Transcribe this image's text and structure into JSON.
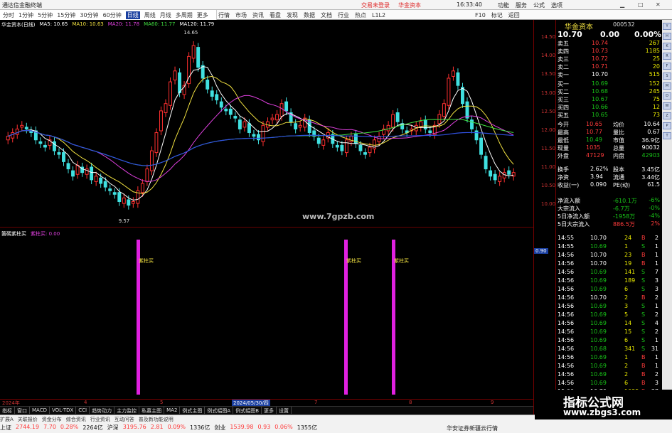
{
  "app": {
    "title": "通达信金融终端",
    "menu": [
      "行情",
      "市场",
      "资讯",
      "看盘",
      "发现",
      "数据",
      "文档",
      "行业",
      "热点",
      "L1L2"
    ],
    "right_title_links": [
      "交易未登录",
      "华金资本"
    ],
    "clock": "16:33:40",
    "title_buttons": [
      "功能",
      "服务",
      "公式",
      "选项"
    ]
  },
  "periods": [
    "分时",
    "1分钟",
    "5分钟",
    "15分钟",
    "30分钟",
    "60分钟",
    "日线",
    "周线",
    "月线",
    "多周期",
    "更多"
  ],
  "active_period": "日线",
  "right_menu": [
    "F10",
    "标记",
    "返回"
  ],
  "chart_header": {
    "stock": "华金资本(日线)",
    "ma": [
      {
        "label": "MA5: 10.65",
        "color": "#ffffff"
      },
      {
        "label": "MA10: 10.63",
        "color": "#f0e040"
      },
      {
        "label": "MA20: 11.78",
        "color": "#e040e0"
      },
      {
        "label": "MA60: 11.77",
        "color": "#40e040"
      },
      {
        "label": "MA120: 11.79",
        "color": "#ffffff"
      }
    ]
  },
  "price_labels": {
    "high": "14.65",
    "low": "9.57"
  },
  "price_scale": [
    "14.50",
    "14.00",
    "13.50",
    "13.00",
    "12.50",
    "12.00",
    "11.50",
    "11.00",
    "10.50",
    "10.00"
  ],
  "watermark_center": "www.7gpzb.com",
  "indicator": {
    "name": "籌碼紫柱买",
    "sub": "紫柱买: 0.00",
    "marker": "紫柱买",
    "value_badge": "0.90"
  },
  "x_axis": [
    {
      "label": "2024年",
      "highlight": false
    },
    {
      "label": "4",
      "highlight": false
    },
    {
      "label": "5",
      "highlight": false
    },
    {
      "label": "2024/05/30/四",
      "highlight": true
    },
    {
      "label": "7",
      "highlight": false
    },
    {
      "label": "8",
      "highlight": false
    },
    {
      "label": "9",
      "highlight": false
    }
  ],
  "tabs": [
    "指标",
    "窗口",
    "MACD",
    "VOL-TDX",
    "CCI",
    "趋势动力",
    "主力监控",
    "私募主图",
    "MA2",
    "例式主图",
    "例式幅图A",
    "例式幅图B",
    "更多",
    "设置"
  ],
  "tabs2": [
    "扩展A",
    "关联报价",
    "资金分布",
    "综合资讯",
    "行业资讯",
    "互动问答",
    "普及新功能说明"
  ],
  "quote_panel": {
    "name": "华金资本",
    "code": "000532",
    "price": "10.70",
    "change": "0.00",
    "pct": "0.00%",
    "asks": [
      {
        "label": "卖五",
        "price": "10.74",
        "vol": "267"
      },
      {
        "label": "卖四",
        "price": "10.73",
        "vol": "1185"
      },
      {
        "label": "卖三",
        "price": "10.72",
        "vol": "25"
      },
      {
        "label": "卖二",
        "price": "10.71",
        "vol": "20"
      },
      {
        "label": "卖一",
        "price": "10.70",
        "vol": "515"
      }
    ],
    "bids": [
      {
        "label": "买一",
        "price": "10.69",
        "vol": "152"
      },
      {
        "label": "买二",
        "price": "10.68",
        "vol": "245"
      },
      {
        "label": "买三",
        "price": "10.67",
        "vol": "75"
      },
      {
        "label": "买四",
        "price": "10.66",
        "vol": "12"
      },
      {
        "label": "买五",
        "price": "10.65",
        "vol": "73"
      }
    ],
    "stats": [
      {
        "l1": "今开",
        "v1": "10.65",
        "l2": "均价",
        "v2": "10.64"
      },
      {
        "l1": "最高",
        "v1": "10.77",
        "l2": "量比",
        "v2": "0.67"
      },
      {
        "l1": "最低",
        "v1": "10.49",
        "l2": "市值",
        "v2": "36.9亿"
      },
      {
        "l1": "现量",
        "v1": "1035",
        "l2": "总量",
        "v2": "90032"
      },
      {
        "l1": "外盘",
        "v1": "47129",
        "l2": "内盘",
        "v2": "42903"
      }
    ],
    "stats2": [
      {
        "l1": "换手",
        "v1": "2.62%",
        "l2": "股本",
        "v2": "3.45亿"
      },
      {
        "l1": "净资",
        "v1": "3.94",
        "l2": "流通",
        "v2": "3.44亿"
      },
      {
        "l1": "收益(一)",
        "v1": "0.090",
        "l2": "PE(动)",
        "v2": "61.5"
      }
    ],
    "flows": [
      {
        "label": "净流入额",
        "value": "-610.1万",
        "pct": "-6%"
      },
      {
        "label": "大宗流入",
        "value": "-6.7万",
        "pct": "-0%"
      },
      {
        "label": "5日净流入额",
        "value": "-1958万",
        "pct": "-4%"
      },
      {
        "label": "5日大宗流入",
        "value": "886.5万",
        "pct": "2%"
      }
    ],
    "ticks": [
      {
        "t": "14:55",
        "p": "10.70",
        "v": "24",
        "s": "B",
        "n": "2"
      },
      {
        "t": "14:55",
        "p": "10.69",
        "v": "1",
        "s": "S",
        "n": "1"
      },
      {
        "t": "14:56",
        "p": "10.70",
        "v": "23",
        "s": "B",
        "n": "1"
      },
      {
        "t": "14:56",
        "p": "10.70",
        "v": "19",
        "s": "B",
        "n": "1"
      },
      {
        "t": "14:56",
        "p": "10.69",
        "v": "141",
        "s": "S",
        "n": "7"
      },
      {
        "t": "14:56",
        "p": "10.69",
        "v": "189",
        "s": "S",
        "n": "3"
      },
      {
        "t": "14:56",
        "p": "10.69",
        "v": "6",
        "s": "S",
        "n": "3"
      },
      {
        "t": "14:56",
        "p": "10.70",
        "v": "2",
        "s": "B",
        "n": "2"
      },
      {
        "t": "14:56",
        "p": "10.69",
        "v": "3",
        "s": "S",
        "n": "1"
      },
      {
        "t": "14:56",
        "p": "10.69",
        "v": "5",
        "s": "S",
        "n": "2"
      },
      {
        "t": "14:56",
        "p": "10.69",
        "v": "14",
        "s": "S",
        "n": "4"
      },
      {
        "t": "14:56",
        "p": "10.69",
        "v": "15",
        "s": "S",
        "n": "2"
      },
      {
        "t": "14:56",
        "p": "10.69",
        "v": "6",
        "s": "S",
        "n": "1"
      },
      {
        "t": "14:56",
        "p": "10.68",
        "v": "341",
        "s": "S",
        "n": "31"
      },
      {
        "t": "14:56",
        "p": "10.69",
        "v": "1",
        "s": "B",
        "n": "1"
      },
      {
        "t": "14:56",
        "p": "10.69",
        "v": "2",
        "s": "B",
        "n": "1"
      },
      {
        "t": "14:56",
        "p": "10.69",
        "v": "2",
        "s": "B",
        "n": "2"
      },
      {
        "t": "14:56",
        "p": "10.69",
        "v": "6",
        "s": "B",
        "n": "3"
      },
      {
        "t": "15:00",
        "p": "10.70",
        "v": "1035",
        "s": "B",
        "n": "37"
      }
    ]
  },
  "status": {
    "items": [
      {
        "label": "上证",
        "v": "2744.19",
        "c": "7.70",
        "p": "0.28%",
        "amt": "2264亿"
      },
      {
        "label": "沪深",
        "v": "3195.76",
        "c": "2.81",
        "p": "0.09%",
        "amt": "1336亿"
      },
      {
        "label": "创业",
        "v": "1539.98",
        "c": "0.93",
        "p": "0.06%",
        "amt": "1355亿"
      }
    ],
    "right": "华安证券新疆云行情"
  },
  "watermark_br": {
    "big": "指标公式网",
    "url": "www.zbgs3.com"
  }
}
